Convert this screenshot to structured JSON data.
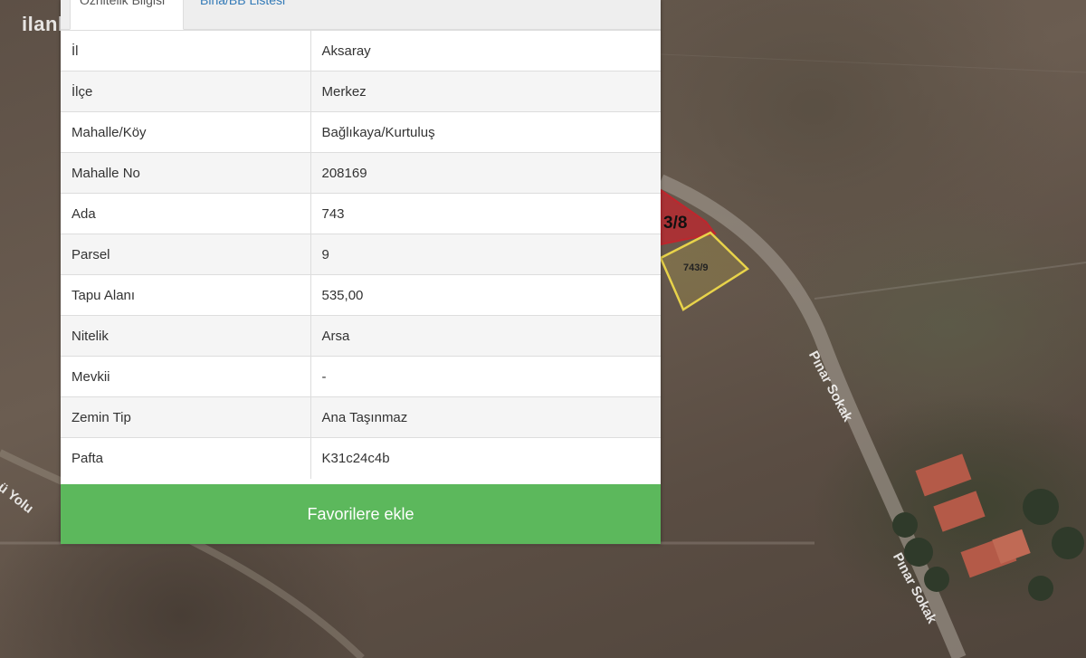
{
  "watermark": "ilanl",
  "tabs": [
    {
      "label": "Öznitelik Bilgisi",
      "active": true
    },
    {
      "label": "Bina/BB Listesi",
      "active": false
    }
  ],
  "attributes": [
    {
      "key": "İl",
      "value": "Aksaray"
    },
    {
      "key": "İlçe",
      "value": "Merkez"
    },
    {
      "key": "Mahalle/Köy",
      "value": "Bağlıkaya/Kurtuluş"
    },
    {
      "key": "Mahalle No",
      "value": "208169"
    },
    {
      "key": "Ada",
      "value": "743"
    },
    {
      "key": "Parsel",
      "value": "9"
    },
    {
      "key": "Tapu Alanı",
      "value": "535,00"
    },
    {
      "key": "Nitelik",
      "value": "Arsa"
    },
    {
      "key": "Mevkii",
      "value": "-"
    },
    {
      "key": "Zemin Tip",
      "value": "Ana Taşınmaz"
    },
    {
      "key": "Pafta",
      "value": "K31c24c4b"
    }
  ],
  "favorite_button": "Favorilere ekle",
  "map": {
    "parcel_neighbor_label": "3/8",
    "parcel_selected_label": "743/9",
    "road_labels": [
      "Pınar Sokak",
      "Pınar Sokak",
      "ü Yolu"
    ]
  },
  "colors": {
    "button_green": "#5cb85c",
    "tab_link": "#337ab7",
    "parcel_highlight": "#e8d34a",
    "parcel_neighbor": "#c0262d"
  }
}
